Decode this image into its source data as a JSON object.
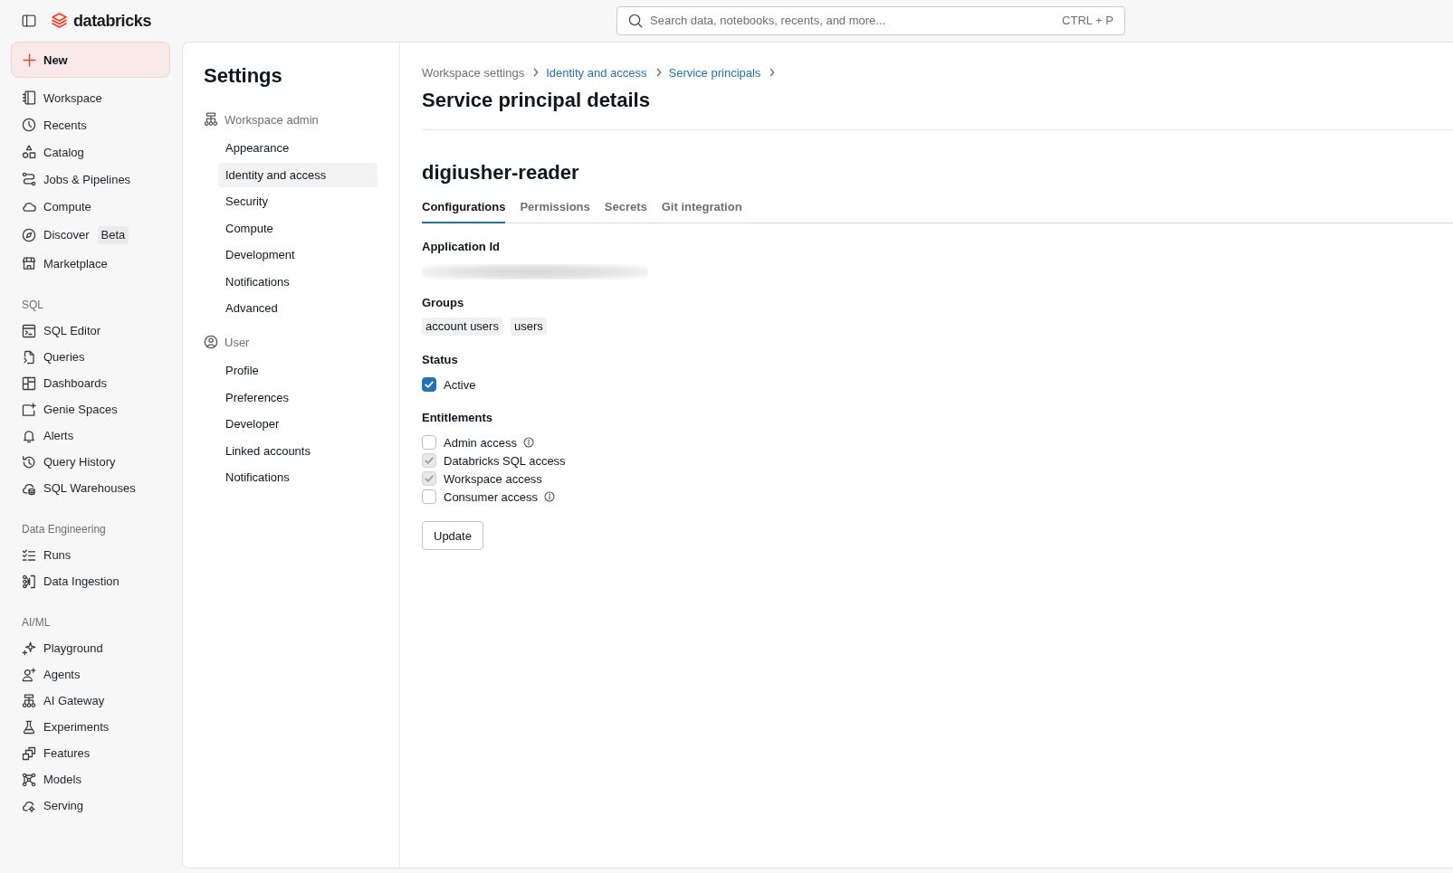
{
  "topbar": {
    "logo_text": "databricks",
    "search": {
      "placeholder": "Search data, notebooks, recents, and more...",
      "shortcut": "CTRL + P"
    }
  },
  "sidebar": {
    "new_button": "New",
    "sections": [
      {
        "items": [
          {
            "label": "Workspace",
            "selected": false
          },
          {
            "label": "Recents",
            "selected": false
          },
          {
            "label": "Catalog",
            "selected": false
          },
          {
            "label": "Jobs & Pipelines",
            "selected": false
          },
          {
            "label": "Compute",
            "selected": false
          },
          {
            "label": "Discover",
            "selected": false,
            "badge": "Beta"
          },
          {
            "label": "Marketplace",
            "selected": false
          }
        ]
      },
      {
        "title": "SQL",
        "items": [
          {
            "label": "SQL Editor",
            "selected": false
          },
          {
            "label": "Queries",
            "selected": false
          },
          {
            "label": "Dashboards",
            "selected": false
          },
          {
            "label": "Genie Spaces",
            "selected": false
          },
          {
            "label": "Alerts",
            "selected": false
          },
          {
            "label": "Query History",
            "selected": false
          },
          {
            "label": "SQL Warehouses",
            "selected": false
          }
        ]
      },
      {
        "title": "Data Engineering",
        "items": [
          {
            "label": "Runs",
            "selected": false
          },
          {
            "label": "Data Ingestion",
            "selected": false
          }
        ]
      },
      {
        "title": "AI/ML",
        "items": [
          {
            "label": "Playground",
            "selected": false
          },
          {
            "label": "Agents",
            "selected": false
          },
          {
            "label": "AI Gateway",
            "selected": false
          },
          {
            "label": "Experiments",
            "selected": false
          },
          {
            "label": "Features",
            "selected": false
          },
          {
            "label": "Models",
            "selected": false
          },
          {
            "label": "Serving",
            "selected": false
          }
        ]
      }
    ]
  },
  "settings_nav": {
    "title": "Settings",
    "groups": [
      {
        "title": "Workspace admin",
        "items": [
          {
            "label": "Appearance",
            "selected": false
          },
          {
            "label": "Identity and access",
            "selected": true
          },
          {
            "label": "Security",
            "selected": false
          },
          {
            "label": "Compute",
            "selected": false
          },
          {
            "label": "Development",
            "selected": false
          },
          {
            "label": "Notifications",
            "selected": false
          },
          {
            "label": "Advanced",
            "selected": false
          }
        ]
      },
      {
        "title": "User",
        "items": [
          {
            "label": "Profile",
            "selected": false
          },
          {
            "label": "Preferences",
            "selected": false
          },
          {
            "label": "Developer",
            "selected": false
          },
          {
            "label": "Linked accounts",
            "selected": false
          },
          {
            "label": "Notifications",
            "selected": false
          }
        ]
      }
    ]
  },
  "breadcrumb": [
    {
      "label": "Workspace settings",
      "link": false
    },
    {
      "label": "Identity and access",
      "link": true
    },
    {
      "label": "Service principals",
      "link": true
    }
  ],
  "page_title": "Service principal details",
  "principal": {
    "name": "digiusher-reader",
    "tabs": [
      {
        "label": "Configurations",
        "selected": true
      },
      {
        "label": "Permissions",
        "selected": false
      },
      {
        "label": "Secrets",
        "selected": false
      },
      {
        "label": "Git integration",
        "selected": false
      }
    ],
    "application_id": {
      "label": "Application Id"
    },
    "groups": {
      "label": "Groups",
      "chips": [
        "account users",
        "users"
      ]
    },
    "status": {
      "label": "Status",
      "options": [
        {
          "label": "Active",
          "checked": true
        }
      ]
    },
    "entitlements": {
      "label": "Entitlements",
      "items": [
        {
          "label": "Admin access",
          "checked": false,
          "disabled": false,
          "info": true
        },
        {
          "label": "Databricks SQL access",
          "checked": true,
          "disabled": true,
          "info": false
        },
        {
          "label": "Workspace access",
          "checked": true,
          "disabled": true,
          "info": false
        },
        {
          "label": "Consumer access",
          "checked": false,
          "disabled": false,
          "info": true
        }
      ]
    },
    "update_button": "Update"
  }
}
